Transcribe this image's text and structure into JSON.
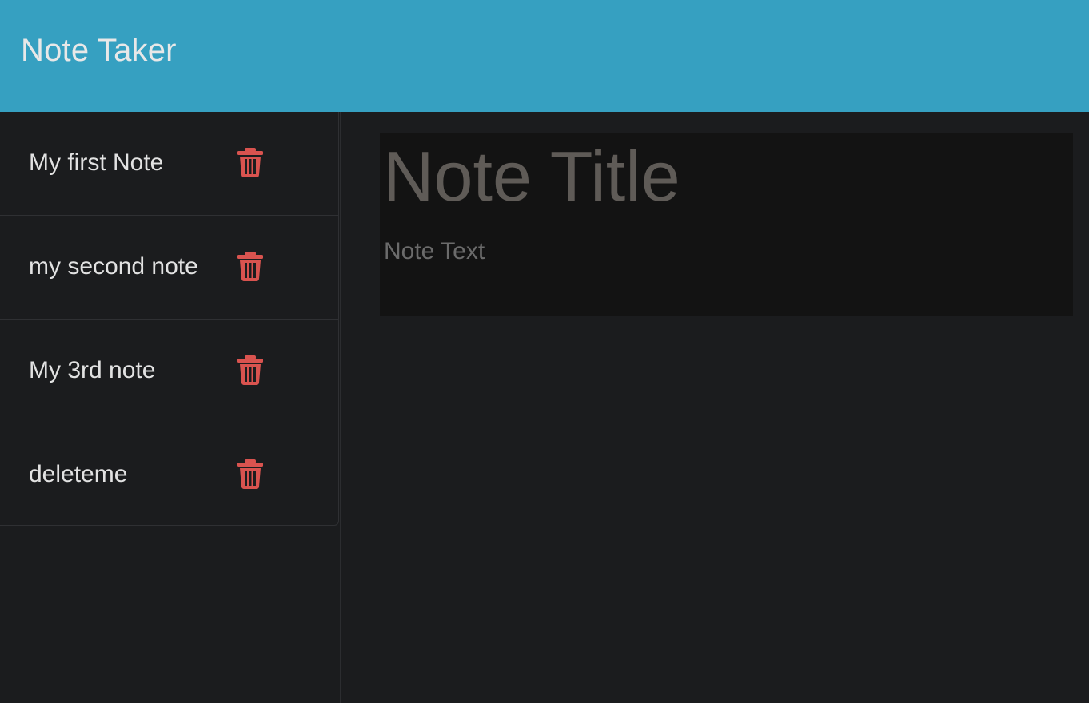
{
  "app": {
    "title": "Note Taker"
  },
  "notes": [
    {
      "label": "My first Note",
      "icon": "trash-icon"
    },
    {
      "label": "my second note",
      "icon": "trash-icon"
    },
    {
      "label": "My 3rd note",
      "icon": "trash-icon"
    },
    {
      "label": "deleteme",
      "icon": "trash-icon"
    }
  ],
  "editor": {
    "title_placeholder": "Note Title",
    "text_placeholder": "Note Text"
  },
  "colors": {
    "navbar": "#36a0c1",
    "background": "#1b1c1e",
    "delete_icon": "#d9534f",
    "editor_background": "#131313"
  }
}
